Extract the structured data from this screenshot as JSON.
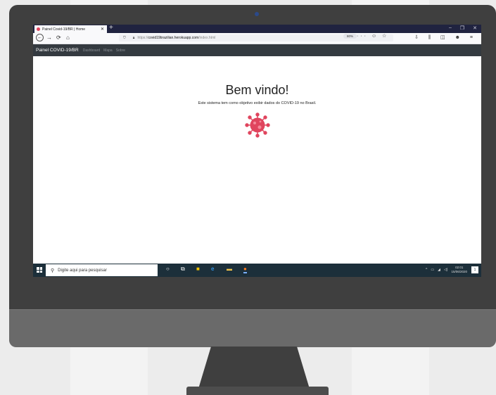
{
  "browser": {
    "tab_title": "Painel Covid-19/BR | Home",
    "tab_close": "✕",
    "new_tab": "+",
    "window_controls": {
      "minimize": "–",
      "maximize": "❐",
      "close": "✕"
    },
    "url": {
      "protocol": "https://",
      "host": "covid19brazilian.herokuapp.com",
      "path": "/index.html"
    },
    "zoom_label": "80%",
    "page_actions": "··· ☺ ☆",
    "toolbar_icons": "⇩ ⫼ ◫ ☻ ≡"
  },
  "app": {
    "brand": "Painel COVID-19/BR",
    "nav": [
      "Dashboard",
      "Mapa",
      "Sobre"
    ],
    "title": "Bem vindo!",
    "subtitle": "Este sistema tem como objetivo exibir dados do COVID-19 no Brasil."
  },
  "taskbar": {
    "search_placeholder": "Digite aqui para pesquisar",
    "time": "02:01",
    "date": "15/06/2020",
    "notification_count": "1",
    "icons": [
      "cortana-circle-icon",
      "task-view-icon",
      "sticky-notes-icon",
      "edge-icon",
      "file-explorer-icon",
      "firefox-icon"
    ]
  },
  "colors": {
    "tabbar": "#202340",
    "navbar": "#343a40",
    "virus": "#e0455e",
    "taskbar": "#1c2f3a",
    "bezel": "#3f3f3f"
  }
}
